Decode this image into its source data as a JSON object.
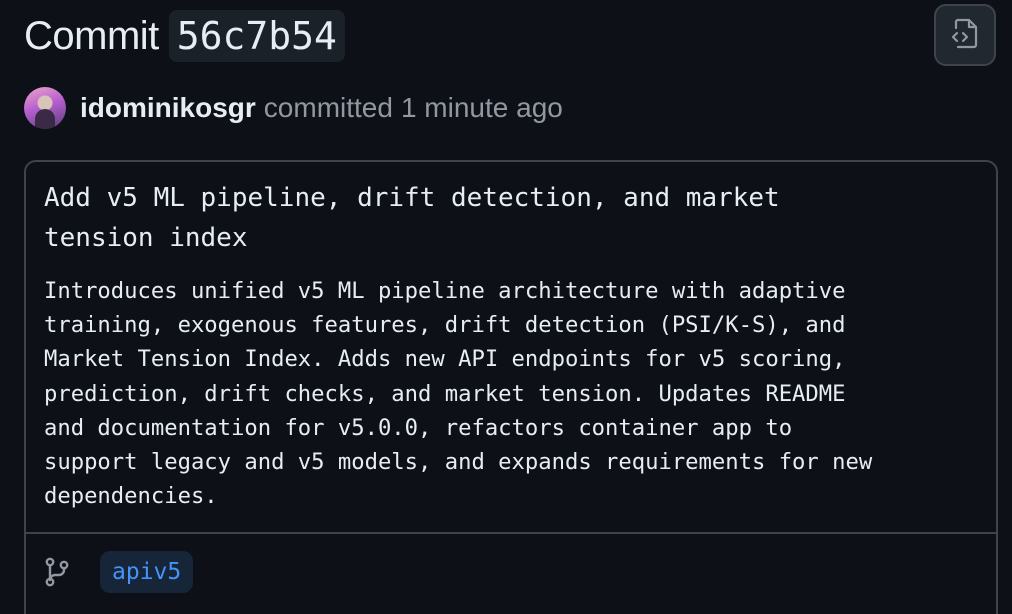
{
  "header": {
    "title_word": "Commit",
    "sha": "56c7b54",
    "browse_icon": "file-code-icon"
  },
  "meta": {
    "author": "idominikosgr",
    "verb": "committed",
    "time": "1 minute ago"
  },
  "message": {
    "title": "Add v5 ML pipeline, drift detection, and market\ntension index",
    "body": "Introduces unified v5 ML pipeline architecture with adaptive\ntraining, exogenous features, drift detection (PSI/K-S), and\nMarket Tension Index. Adds new API endpoints for v5 scoring,\nprediction, drift checks, and market tension. Updates README\nand documentation for v5.0.0, refactors container app to\nsupport legacy and v5 models, and expands requirements for new\ndependencies."
  },
  "branch": {
    "icon": "git-branch-icon",
    "name": "apiv5"
  },
  "colors": {
    "background": "#0d1117",
    "border": "#3d444d",
    "text": "#e6edf3",
    "muted": "#9198a1",
    "branch_link": "#4493f8",
    "branch_bg": "#172538"
  }
}
